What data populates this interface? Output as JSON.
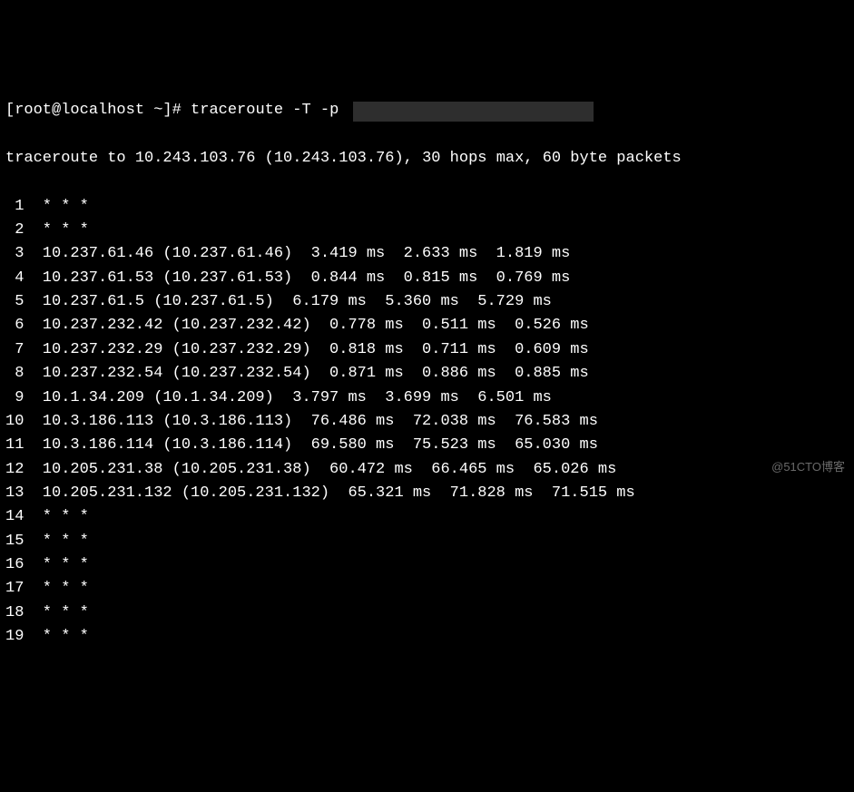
{
  "prompt": {
    "user_host": "[root@localhost ~]# ",
    "command": "traceroute -T -p "
  },
  "summary": "traceroute to 10.243.103.76 (10.243.103.76), 30 hops max, 60 byte packets",
  "hops": [
    {
      "num": "1",
      "rest": "  * * *"
    },
    {
      "num": "2",
      "rest": "  * * *"
    },
    {
      "num": "3",
      "rest": "  10.237.61.46 (10.237.61.46)  3.419 ms  2.633 ms  1.819 ms"
    },
    {
      "num": "4",
      "rest": "  10.237.61.53 (10.237.61.53)  0.844 ms  0.815 ms  0.769 ms"
    },
    {
      "num": "5",
      "rest": "  10.237.61.5 (10.237.61.5)  6.179 ms  5.360 ms  5.729 ms"
    },
    {
      "num": "6",
      "rest": "  10.237.232.42 (10.237.232.42)  0.778 ms  0.511 ms  0.526 ms"
    },
    {
      "num": "7",
      "rest": "  10.237.232.29 (10.237.232.29)  0.818 ms  0.711 ms  0.609 ms"
    },
    {
      "num": "8",
      "rest": "  10.237.232.54 (10.237.232.54)  0.871 ms  0.886 ms  0.885 ms"
    },
    {
      "num": "9",
      "rest": "  10.1.34.209 (10.1.34.209)  3.797 ms  3.699 ms  6.501 ms"
    },
    {
      "num": "10",
      "rest": "  10.3.186.113 (10.3.186.113)  76.486 ms  72.038 ms  76.583 ms"
    },
    {
      "num": "11",
      "rest": "  10.3.186.114 (10.3.186.114)  69.580 ms  75.523 ms  65.030 ms"
    },
    {
      "num": "12",
      "rest": "  10.205.231.38 (10.205.231.38)  60.472 ms  66.465 ms  65.026 ms"
    },
    {
      "num": "13",
      "rest": "  10.205.231.132 (10.205.231.132)  65.321 ms  71.828 ms  71.515 ms"
    },
    {
      "num": "14",
      "rest": "  * * *"
    },
    {
      "num": "15",
      "rest": "  * * *"
    },
    {
      "num": "16",
      "rest": "  * * *"
    },
    {
      "num": "17",
      "rest": "  * * *"
    },
    {
      "num": "18",
      "rest": "  * * *"
    },
    {
      "num": "19",
      "rest": "  * * *"
    }
  ],
  "watermark": "@51CTO博客"
}
